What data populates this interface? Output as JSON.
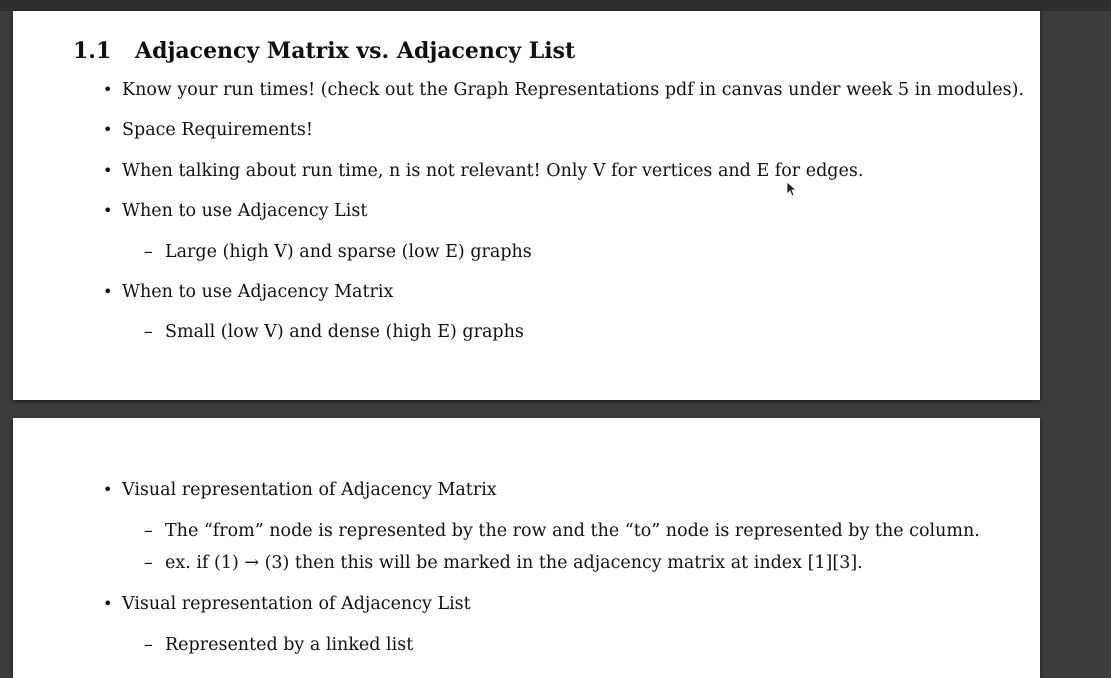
{
  "section": {
    "number": "1.1",
    "title": "Adjacency Matrix vs. Adjacency List"
  },
  "page1": {
    "bullets": [
      "Know your run times! (check out the Graph Representations pdf in canvas under week 5 in modules).",
      "Space Requirements!",
      "When talking about run time, n is not relevant! Only V for vertices and E for edges.",
      "When to use Adjacency List",
      "When to use Adjacency Matrix"
    ],
    "subs": [
      "Large (high V) and sparse (low E) graphs",
      "Small (low V) and dense (high E) graphs"
    ]
  },
  "page2": {
    "bullets": [
      "Visual representation of Adjacency Matrix",
      "Visual representation of Adjacency List"
    ],
    "subs": [
      "The “from” node is represented by the row and the “to” node is represented by the column.",
      "ex. if (1) → (3) then this will be marked in the adjacency matrix at index [1][3].",
      "Represented by a linked list"
    ]
  },
  "glyphs": {
    "bullet": "•",
    "dash": "–"
  }
}
